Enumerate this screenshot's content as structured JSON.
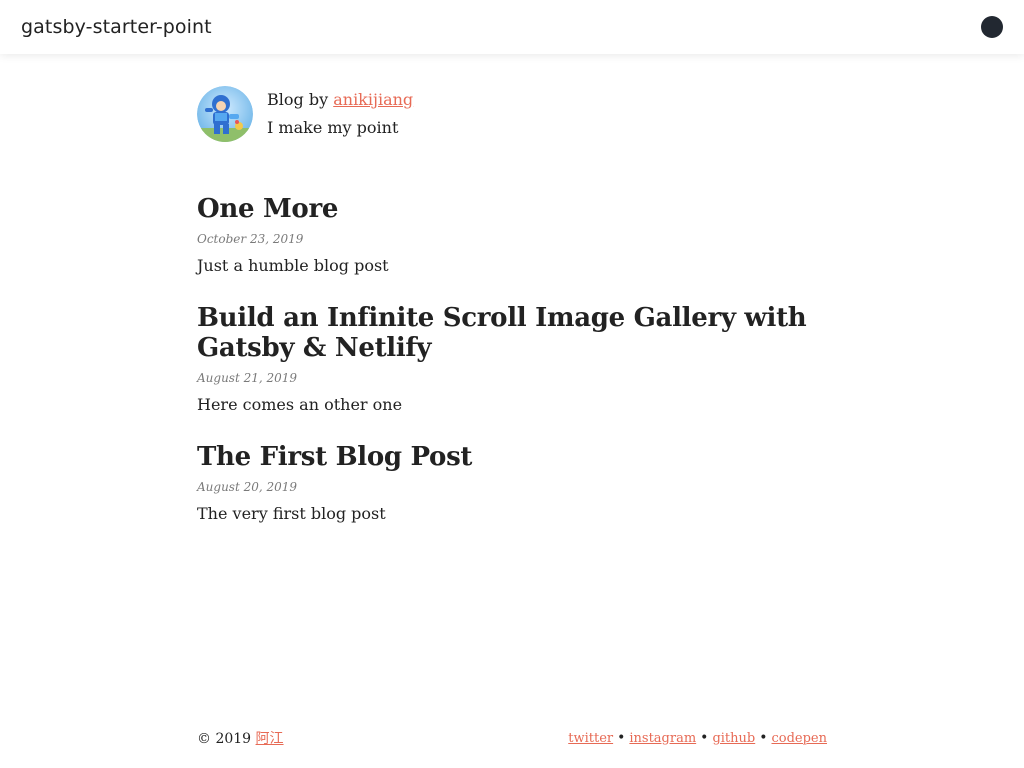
{
  "header": {
    "site_title": "gatsby-starter-point",
    "theme_toggle_color": "#222831"
  },
  "bio": {
    "prefix": "Blog by",
    "author": "anikijiang",
    "tagline": "I make my point"
  },
  "posts": [
    {
      "title": "One More",
      "date": "October 23, 2019",
      "excerpt": "Just a humble blog post"
    },
    {
      "title": "Build an Infinite Scroll Image Gallery with Gatsby & Netlify",
      "date": "August 21, 2019",
      "excerpt": "Here comes an other one"
    },
    {
      "title": "The First Blog Post",
      "date": "August 20, 2019",
      "excerpt": "The very first blog post"
    }
  ],
  "footer": {
    "copyright": "© 2019",
    "owner": "阿江",
    "social": [
      "twitter",
      "instagram",
      "github",
      "codepen"
    ],
    "separator": "•"
  },
  "colors": {
    "accent": "#e76a55",
    "text": "#222222",
    "date": "#7a7a7a"
  }
}
